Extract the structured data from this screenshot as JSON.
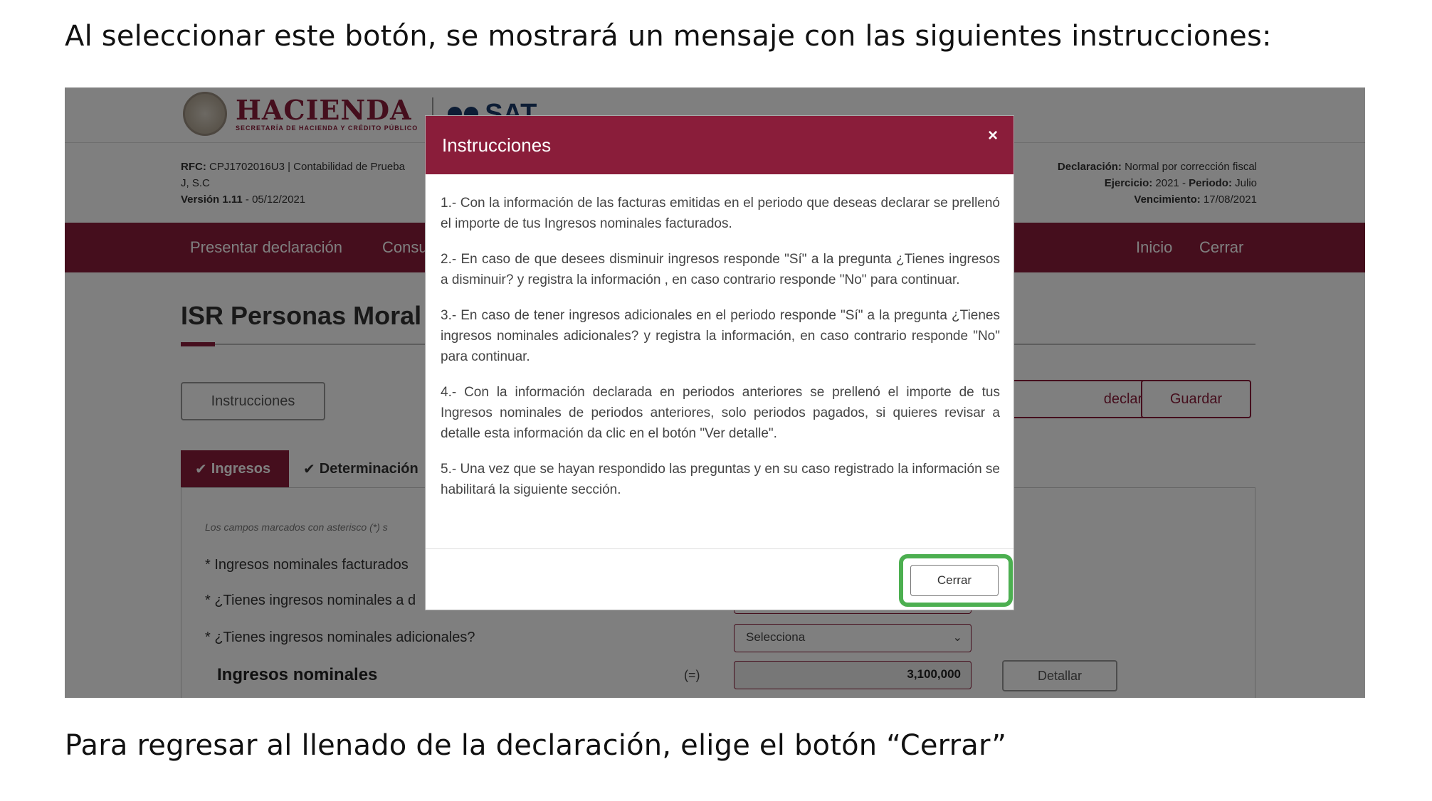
{
  "intro_text": "Al seleccionar este botón, se mostrará un mensaje con las siguientes instrucciones:",
  "outro_text": "Para regresar al llenado de la declaración, elige el botón “Cerrar”",
  "header": {
    "brand": "HACIENDA",
    "brand_sub": "SECRETARÍA DE HACIENDA Y CRÉDITO PÚBLICO",
    "sat": "SAT"
  },
  "info_left": {
    "rfc_label": "RFC:",
    "rfc_value": "CPJ1702016U3 | Contabilidad de Prueba",
    "rfc_cont": "J, S.C",
    "version_label": "Versión 1.11",
    "version_date": "- 05/12/2021"
  },
  "info_right": {
    "decl_label": "Declaración:",
    "decl_value": "Normal por corrección fiscal",
    "ejercicio_label": "Ejercicio:",
    "ejercicio_value": "2021 -",
    "periodo_label": "Periodo:",
    "periodo_value": "Julio",
    "venc_label": "Vencimiento:",
    "venc_value": "17/08/2021"
  },
  "nav": {
    "presentar": "Presentar declaración",
    "consultas": "Consu",
    "inicio": "Inicio",
    "cerrar": "Cerrar"
  },
  "page_title": "ISR Personas Moral",
  "buttons": {
    "instrucciones": "Instrucciones",
    "declaracion": "declaración",
    "guardar": "Guardar",
    "detallar": "Detallar"
  },
  "tabs": {
    "ingresos": "Ingresos",
    "determinacion": "Determinación"
  },
  "form": {
    "note": "Los campos marcados con asterisco (*) s",
    "f1": "* Ingresos nominales facturados",
    "f2": "* ¿Tienes ingresos nominales a d",
    "f3": "* ¿Tienes ingresos nominales adicionales?",
    "select_placeholder": "Selecciona",
    "total_label": "Ingresos nominales",
    "eq": "(=)",
    "total_value": "3,100,000"
  },
  "modal": {
    "title": "Instrucciones",
    "close": "×",
    "p1": "1.- Con la información de las facturas emitidas en el periodo que deseas declarar se prellenó el importe de tus Ingresos nominales facturados.",
    "p2": "2.- En caso de que desees disminuir ingresos responde \"Sí\" a la pregunta ¿Tienes ingresos a disminuir? y registra la información , en caso contrario responde \"No\" para continuar.",
    "p3": "3.- En caso de tener ingresos adicionales en el periodo responde \"Sí\" a la pregunta ¿Tienes ingresos nominales adicionales? y registra la información, en caso contrario responde \"No\" para continuar.",
    "p4": "4.- Con la información declarada en periodos anteriores se prellenó el importe de tus Ingresos nominales de periodos anteriores, solo periodos pagados, si quieres revisar a detalle esta información da clic en el botón \"Ver detalle\".",
    "p5": "5.- Una vez que se hayan respondido las preguntas y en su caso registrado la información se habilitará la siguiente sección.",
    "cerrar": "Cerrar",
    "highlight_color": "#4caf50"
  },
  "colors": {
    "brand": "#8a1d3a",
    "sat_blue": "#1a3a6a"
  }
}
